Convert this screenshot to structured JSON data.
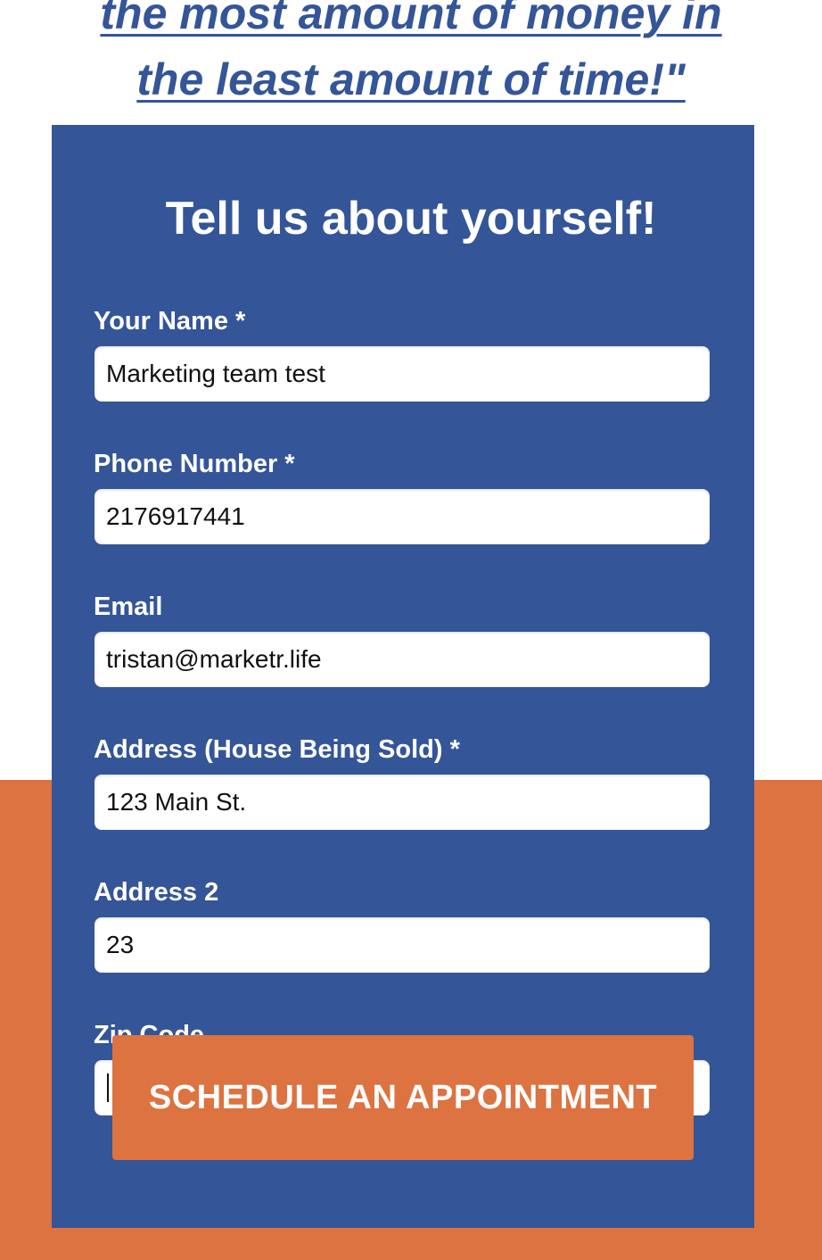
{
  "headline": {
    "line1": "the most amount of money in",
    "line2": "the least amount of time!\""
  },
  "form": {
    "title": "Tell us about yourself!",
    "fields": [
      {
        "label": "Your Name *",
        "value": "Marketing team test"
      },
      {
        "label": "Phone Number *",
        "value": "2176917441"
      },
      {
        "label": "Email",
        "value": "tristan@marketr.life"
      },
      {
        "label": "Address (House Being Sold) *",
        "value": "123 Main St."
      },
      {
        "label": "Address 2",
        "value": "23"
      },
      {
        "label": "Zip Code",
        "value": ""
      }
    ],
    "submit_label": "SCHEDULE AN APPOINTMENT"
  },
  "colors": {
    "panel_blue": "#345597",
    "accent_orange": "#dc7340",
    "headline_blue": "#345597"
  }
}
